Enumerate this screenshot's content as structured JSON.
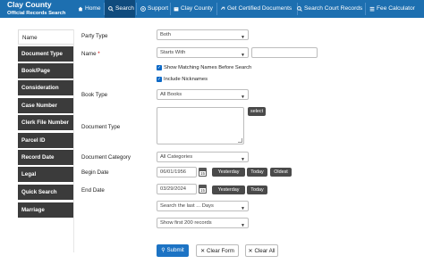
{
  "header": {
    "brand_line1": "Clay County",
    "brand_line2": "Official Records Search",
    "nav": [
      {
        "label": "Home",
        "icon": "home-icon"
      },
      {
        "label": "Search",
        "icon": "search-icon"
      },
      {
        "label": "Support",
        "icon": "support-icon"
      },
      {
        "label": "Clay County",
        "icon": "building-icon"
      },
      {
        "label": "Get Certified Documents",
        "icon": "link-icon"
      },
      {
        "label": "Search Court Records",
        "icon": "search-icon"
      },
      {
        "label": "Fee Calculator",
        "icon": "list-icon"
      }
    ],
    "colors": {
      "bar": "#1d6fb0",
      "active": "#0f4b7d"
    }
  },
  "tabs": [
    "Name",
    "Document Type",
    "Book/Page",
    "Consideration",
    "Case Number",
    "Clerk File Number",
    "Parcel ID",
    "Record Date",
    "Legal",
    "Quick Search",
    "Marriage"
  ],
  "form": {
    "party_type_label": "Party Type",
    "party_type_value": "Both",
    "name_label": "Name",
    "name_req": "*",
    "name_mode_value": "Starts With",
    "name_value": "",
    "show_matching_label": "Show Matching Names Before Search",
    "include_nicknames_label": "Include Nicknames",
    "book_type_label": "Book Type",
    "book_type_value": "All Books",
    "document_type_label": "Document Type",
    "select_button": "select",
    "doc_category_label": "Document Category",
    "doc_category_value": "All Categories",
    "begin_date_label": "Begin Date",
    "begin_date_value": "06/01/1956",
    "end_date_label": "End Date",
    "end_date_value": "03/29/2024",
    "yesterday": "Yesterday",
    "today": "Today",
    "oldest": "Oldest",
    "search_last_value": "Search the last ... Days",
    "show_records_value": "Show first 200 records",
    "calendar_day": "15"
  },
  "actions": {
    "submit": "Submit",
    "clear_form": "Clear Form",
    "clear_all": "Clear All"
  }
}
